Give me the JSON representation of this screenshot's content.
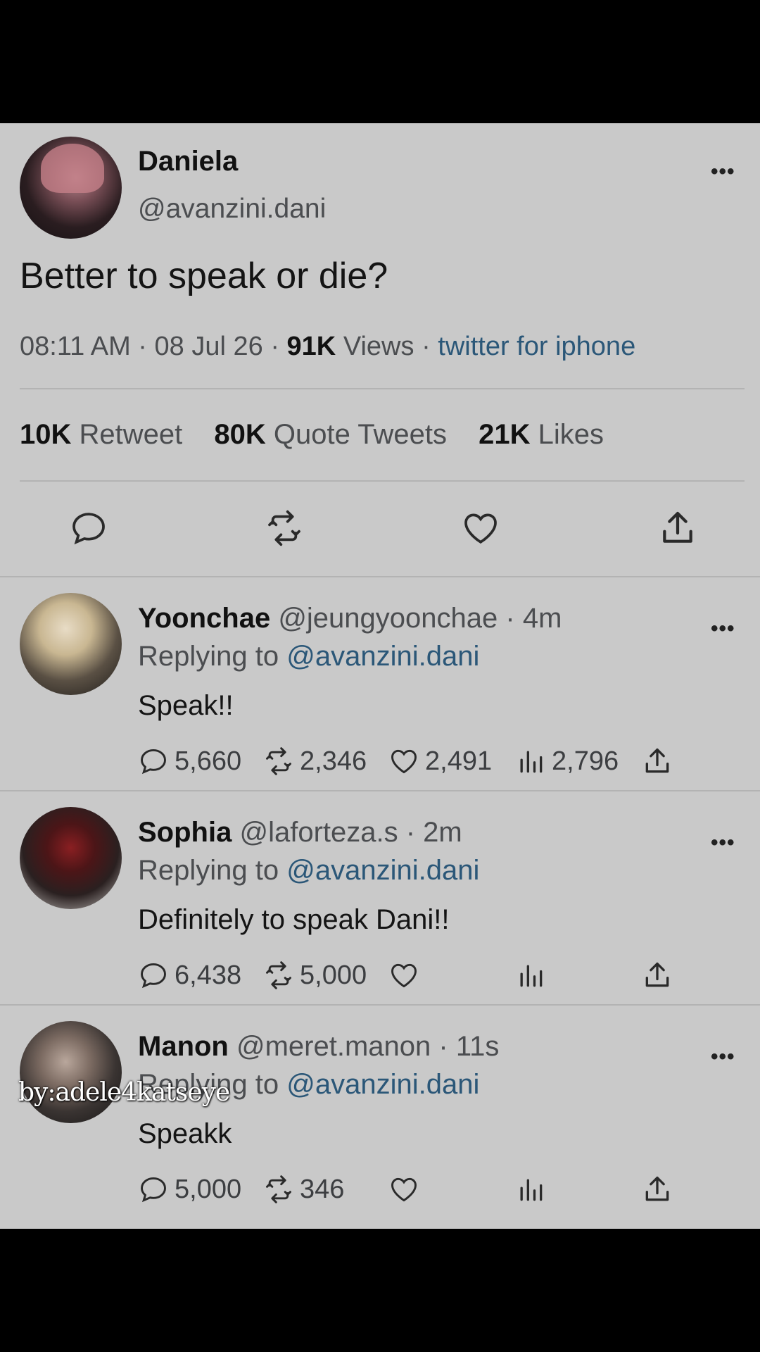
{
  "main": {
    "name": "Daniela",
    "handle": "@avanzini.dani",
    "text": "Better to speak or die?",
    "time": "08:11 AM",
    "date": "08 Jul 26",
    "views_count": "91K",
    "views_label": "Views",
    "source": "twitter for iphone",
    "sep": "·",
    "retweets_count": "10K",
    "retweets_label": "Retweet",
    "quotes_count": "80K",
    "quotes_label": "Quote Tweets",
    "likes_count": "21K",
    "likes_label": "Likes",
    "more": "•••"
  },
  "replies": [
    {
      "name": "Yoonchae",
      "handle": "@jeungyoonchae",
      "age": "· 4m",
      "replying_label": "Replying to",
      "replying_to": "@avanzini.dani",
      "text": "Speak!!",
      "replies": "5,660",
      "retweets": "2,346",
      "likes": "2,491",
      "views": "2,796",
      "more": "•••"
    },
    {
      "name": "Sophia",
      "handle": "@laforteza.s",
      "age": "· 2m",
      "replying_label": "Replying to",
      "replying_to": "@avanzini.dani",
      "text": "Definitely to speak Dani!!",
      "replies": "6,438",
      "retweets": "5,000",
      "more": "•••"
    },
    {
      "name": "Manon",
      "handle": "@meret.manon",
      "age": "· 11s",
      "replying_label": "Replying to",
      "replying_to": "@avanzini.dani",
      "text": "Speakk",
      "replies": "5,000",
      "retweets": "346",
      "more": "•••"
    }
  ],
  "watermark": "by:adele4katseye",
  "colors": {
    "panel": "#c9c9c9",
    "link": "#2b5778",
    "muted": "#4b4d50",
    "background": "#000000"
  },
  "icons": [
    "reply-icon",
    "retweet-icon",
    "like-icon",
    "share-icon",
    "views-icon",
    "more-icon"
  ]
}
